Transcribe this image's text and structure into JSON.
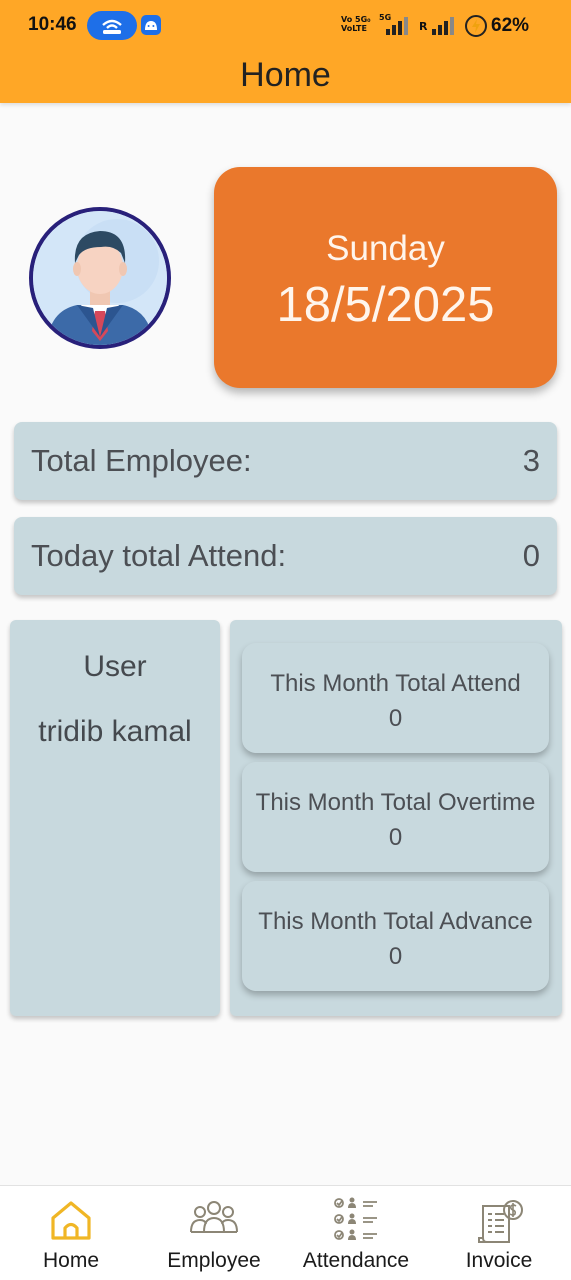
{
  "status_bar": {
    "time": "10:46",
    "net_label_1": "Vo 5G₀",
    "net_label_2": "VoLTE",
    "net_label_5g": "5G",
    "roaming": "R",
    "battery": "62%"
  },
  "app_bar": {
    "title": "Home"
  },
  "date_card": {
    "day": "Sunday",
    "date": "18/5/2025"
  },
  "stats": {
    "total_employee_label": "Total Employee:",
    "total_employee_value": "3",
    "today_attend_label": "Today total Attend:",
    "today_attend_value": "0"
  },
  "user_panel": {
    "heading": "User",
    "name": "tridib kamal"
  },
  "month_summary": [
    {
      "label": "This Month Total Attend",
      "value": "0"
    },
    {
      "label": "This Month Total Overtime",
      "value": "0"
    },
    {
      "label": "This Month Total Advance",
      "value": "0"
    }
  ],
  "bottom_nav": [
    {
      "label": "Home",
      "icon": "home-icon",
      "active": true
    },
    {
      "label": "Employee",
      "icon": "employee-group-icon",
      "active": false
    },
    {
      "label": "Attendance",
      "icon": "attendance-checklist-icon",
      "active": false
    },
    {
      "label": "Invoice",
      "icon": "invoice-icon",
      "active": false
    }
  ],
  "colors": {
    "app_bar": "#ffa726",
    "date_card": "#ea782c",
    "card_bg": "#c8d9de",
    "nav_active_icon": "#f0b625",
    "nav_icon": "#8c8676"
  }
}
